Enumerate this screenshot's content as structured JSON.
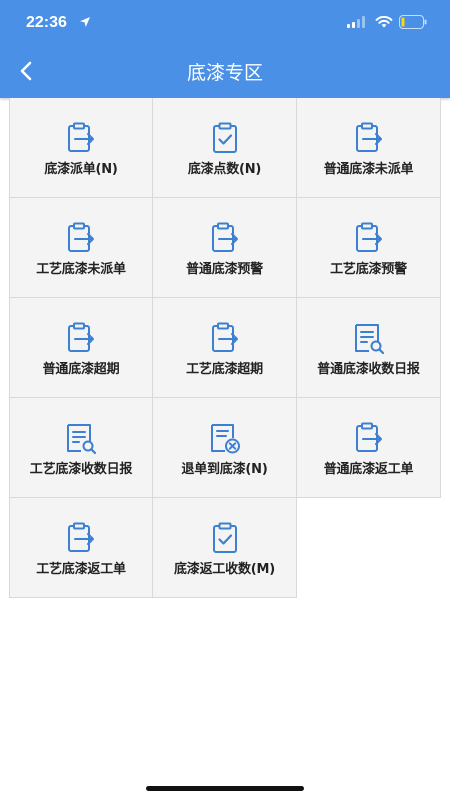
{
  "status": {
    "time": "22:36"
  },
  "header": {
    "title": "底漆专区"
  },
  "tiles": [
    {
      "label": "底漆派单(N)",
      "icon": "clipboard-arrow-icon"
    },
    {
      "label": "底漆点数(N)",
      "icon": "clipboard-check-icon"
    },
    {
      "label": "普通底漆未派单",
      "icon": "clipboard-arrow-icon"
    },
    {
      "label": "工艺底漆未派单",
      "icon": "clipboard-arrow-icon"
    },
    {
      "label": "普通底漆预警",
      "icon": "clipboard-arrow-icon"
    },
    {
      "label": "工艺底漆预警",
      "icon": "clipboard-arrow-icon"
    },
    {
      "label": "普通底漆超期",
      "icon": "clipboard-arrow-icon"
    },
    {
      "label": "工艺底漆超期",
      "icon": "clipboard-arrow-icon"
    },
    {
      "label": "普通底漆收数日报",
      "icon": "report-search-icon"
    },
    {
      "label": "工艺底漆收数日报",
      "icon": "report-search-icon"
    },
    {
      "label": "退单到底漆(N)",
      "icon": "document-cancel-icon"
    },
    {
      "label": "普通底漆返工单",
      "icon": "clipboard-arrow-icon"
    },
    {
      "label": "工艺底漆返工单",
      "icon": "clipboard-arrow-icon"
    },
    {
      "label": "底漆返工收数(M)",
      "icon": "clipboard-check-icon"
    }
  ],
  "colors": {
    "header": "#4a90e6",
    "icon": "#3d7fd0",
    "tile_bg": "#f4f4f4"
  }
}
